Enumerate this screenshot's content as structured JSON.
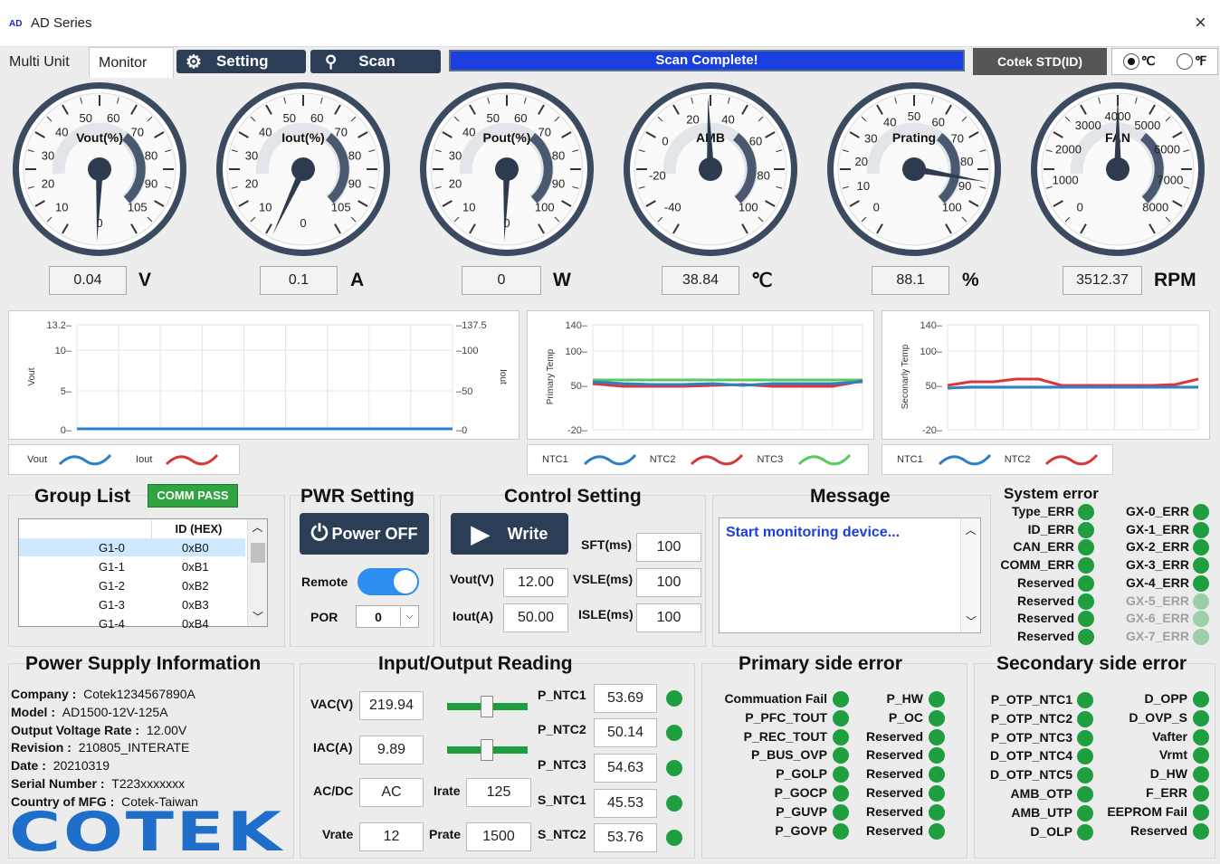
{
  "window": {
    "logo": "AD",
    "title": "AD Series",
    "close": "×"
  },
  "tabs": {
    "multi": "Multi Unit",
    "monitor": "Monitor"
  },
  "toolbar": {
    "setting": "Setting",
    "scan": "Scan",
    "progress": "Scan Complete!",
    "std": "Cotek STD(ID)",
    "celsius": "℃",
    "fahrenheit": "℉"
  },
  "gauges": [
    {
      "label": "Vout(%)",
      "value": "0.04",
      "unit": "V",
      "ticks": [
        "10",
        "20",
        "30",
        "40",
        "50",
        "60",
        "70",
        "80",
        "90",
        "105",
        "0"
      ]
    },
    {
      "label": "Iout(%)",
      "value": "0.1",
      "unit": "A",
      "ticks": [
        "10",
        "20",
        "30",
        "40",
        "50",
        "60",
        "70",
        "80",
        "90",
        "105",
        "0"
      ]
    },
    {
      "label": "Pout(%)",
      "value": "0",
      "unit": "W",
      "ticks": [
        "10",
        "20",
        "30",
        "40",
        "50",
        "60",
        "70",
        "80",
        "90",
        "100",
        "0"
      ]
    },
    {
      "label": "AMB",
      "value": "38.84",
      "unit": "℃",
      "ticks": [
        "-40",
        "-20",
        "0",
        "20",
        "40",
        "60",
        "80",
        "100"
      ]
    },
    {
      "label": "Prating",
      "value": "88.1",
      "unit": "%",
      "ticks": [
        "0",
        "10",
        "20",
        "30",
        "40",
        "50",
        "60",
        "70",
        "80",
        "90",
        "100"
      ]
    },
    {
      "label": "FAN",
      "value": "3512.37",
      "unit": "RPM",
      "ticks": [
        "0",
        "1000",
        "2000",
        "3000",
        "4000",
        "5000",
        "6000",
        "7000",
        "8000"
      ]
    }
  ],
  "charts": {
    "vout": {
      "ylabel": "Vout",
      "y2label": "Iout",
      "yticks": [
        "13.2",
        "10",
        "5",
        "0"
      ],
      "y2ticks": [
        "137.5",
        "100",
        "50",
        "0"
      ],
      "legend": [
        "Vout",
        "Iout"
      ]
    },
    "primary": {
      "ylabel": "Primary Temp",
      "yticks": [
        "140",
        "100",
        "50",
        "-20"
      ],
      "legend": [
        "NTC1",
        "NTC2",
        "NTC3"
      ]
    },
    "secondary": {
      "ylabel": "Seconarly Temp",
      "yticks": [
        "140",
        "100",
        "50",
        "-20"
      ],
      "legend": [
        "NTC1",
        "NTC2"
      ]
    }
  },
  "group": {
    "title": "Group List",
    "badge": "COMM PASS",
    "col": "ID (HEX)",
    "rows": [
      [
        "G1-0",
        "0xB0"
      ],
      [
        "G1-1",
        "0xB1"
      ],
      [
        "G1-2",
        "0xB2"
      ],
      [
        "G1-3",
        "0xB3"
      ],
      [
        "G1-4",
        "0xB4"
      ]
    ]
  },
  "pwr": {
    "title": "PWR Setting",
    "button": "Power OFF",
    "remote": "Remote",
    "por": "POR",
    "por_value": "0"
  },
  "control": {
    "title": "Control Setting",
    "write": "Write",
    "sft": "SFT(ms)",
    "sft_v": "100",
    "vout": "Vout(V)",
    "vout_v": "12.00",
    "vsle": "VSLE(ms)",
    "vsle_v": "100",
    "iout": "Iout(A)",
    "iout_v": "50.00",
    "isle": "ISLE(ms)",
    "isle_v": "100"
  },
  "message": {
    "title": "Message",
    "text": "Start monitoring device..."
  },
  "syserr": {
    "title": "System error",
    "left": [
      "Type_ERR",
      "ID_ERR",
      "CAN_ERR",
      "COMM_ERR",
      "Reserved",
      "Reserved",
      "Reserved",
      "Reserved"
    ],
    "right": [
      "GX-0_ERR",
      "GX-1_ERR",
      "GX-2_ERR",
      "GX-3_ERR",
      "GX-4_ERR",
      "GX-5_ERR",
      "GX-6_ERR",
      "GX-7_ERR"
    ]
  },
  "psinfo": {
    "title": "Power Supply Information",
    "company_l": "Company :",
    "company": "Cotek1234567890A",
    "model_l": "Model :",
    "model": "AD1500-12V-125A",
    "ovr_l": "Output Voltage Rate :",
    "ovr": "12.00V",
    "rev_l": "Revision :",
    "rev": "210805_INTERATE",
    "date_l": "Date :",
    "date": "20210319",
    "sn_l": "Serial Number :",
    "sn": "T223xxxxxxx",
    "mfg_l": "Country of MFG :",
    "mfg": "Cotek-Taiwan",
    "brand": "COTEK"
  },
  "io": {
    "title": "Input/Output Reading",
    "vac": "VAC(V)",
    "vac_v": "219.94",
    "iac": "IAC(A)",
    "iac_v": "9.89",
    "acdc": "AC/DC",
    "acdc_v": "AC",
    "irate": "Irate",
    "irate_v": "125",
    "vrate": "Vrate",
    "vrate_v": "12",
    "prate": "Prate",
    "prate_v": "1500",
    "ntc": [
      [
        "P_NTC1",
        "53.69"
      ],
      [
        "P_NTC2",
        "50.14"
      ],
      [
        "P_NTC3",
        "54.63"
      ],
      [
        "S_NTC1",
        "45.53"
      ],
      [
        "S_NTC2",
        "53.76"
      ]
    ]
  },
  "primerr": {
    "title": "Primary side error",
    "left": [
      "Commuation Fail",
      "P_PFC_TOUT",
      "P_REC_TOUT",
      "P_BUS_OVP",
      "P_GOLP",
      "P_GOCP",
      "P_GUVP",
      "P_GOVP"
    ],
    "right": [
      "P_HW",
      "P_OC",
      "Reserved",
      "Reserved",
      "Reserved",
      "Reserved",
      "Reserved",
      "Reserved"
    ]
  },
  "secerr": {
    "title": "Secondary side error",
    "left": [
      "P_OTP_NTC1",
      "P_OTP_NTC2",
      "P_OTP_NTC3",
      "D_OTP_NTC4",
      "D_OTP_NTC5",
      "AMB_OTP",
      "AMB_UTP",
      "D_OLP"
    ],
    "right": [
      "D_OPP",
      "D_OVP_S",
      "Vafter",
      "Vrmt",
      "D_HW",
      "F_ERR",
      "EEPROM Fail",
      "Reserved"
    ]
  },
  "colors": {
    "accent": "#2c3e56",
    "ok": "#1e9e3e",
    "progress": "#1a3fe0",
    "ntc1": "#2e7fc9",
    "ntc2": "#d9383a",
    "ntc3": "#58c95e"
  }
}
